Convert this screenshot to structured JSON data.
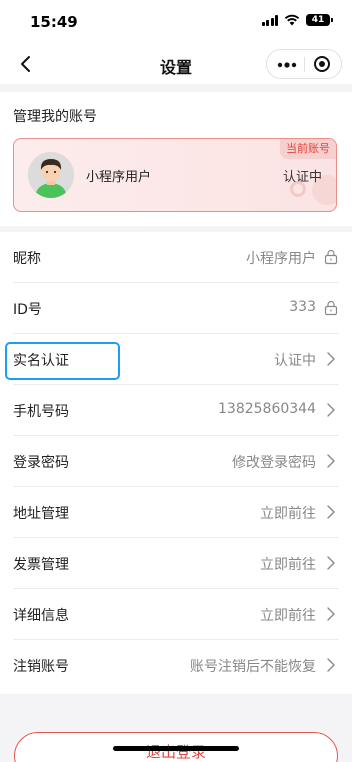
{
  "status_bar": {
    "time": "15:49",
    "battery": "41"
  },
  "nav": {
    "title": "设置"
  },
  "account": {
    "section_title": "管理我的账号",
    "badge": "当前账号",
    "user_name": "小程序用户",
    "user_status": "认证中"
  },
  "settings": [
    {
      "label": "昵称",
      "value": "小程序用户",
      "icon": "lock-icon"
    },
    {
      "label": "ID号",
      "value": "333",
      "icon": "lock-icon"
    },
    {
      "label": "实名认证",
      "value": "认证中",
      "icon": "chevron-right-icon"
    },
    {
      "label": "手机号码",
      "value": "13825860344",
      "icon": "chevron-right-icon"
    },
    {
      "label": "登录密码",
      "value": "修改登录密码",
      "icon": "chevron-right-icon"
    },
    {
      "label": "地址管理",
      "value": "立即前往",
      "icon": "chevron-right-icon"
    },
    {
      "label": "发票管理",
      "value": "立即前往",
      "icon": "chevron-right-icon"
    },
    {
      "label": "详细信息",
      "value": "立即前往",
      "icon": "chevron-right-icon"
    },
    {
      "label": "注销账号",
      "value": "账号注销后不能恢复",
      "icon": "chevron-right-icon"
    }
  ],
  "logout_label": "退出登录",
  "colors": {
    "accent": "#e0453f",
    "highlight": "#1aa0f0",
    "badge_bg": "#f6cfcf"
  }
}
